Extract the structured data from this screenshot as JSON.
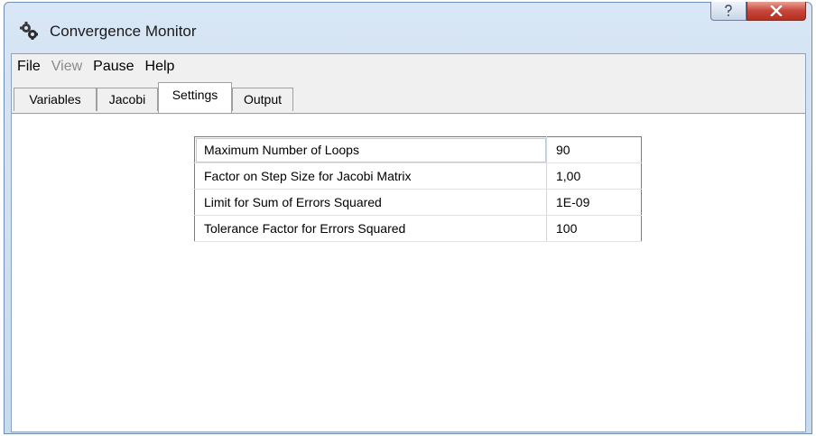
{
  "window": {
    "title": "Convergence Monitor",
    "icon": "gears-icon",
    "help_button": "?",
    "close_button": "X"
  },
  "menu": {
    "items": [
      {
        "label": "File",
        "enabled": true
      },
      {
        "label": "View",
        "enabled": false
      },
      {
        "label": "Pause",
        "enabled": true
      },
      {
        "label": "Help",
        "enabled": true
      }
    ]
  },
  "tabs": {
    "items": [
      {
        "label": "Variables"
      },
      {
        "label": "Jacobi"
      },
      {
        "label": "Settings"
      },
      {
        "label": "Output"
      }
    ],
    "active": "Settings"
  },
  "settings": {
    "rows": [
      {
        "name": "Maximum Number of Loops",
        "value": "90"
      },
      {
        "name": "Factor on Step Size for Jacobi Matrix",
        "value": "1,00"
      },
      {
        "name": "Limit for Sum of Errors Squared",
        "value": "1E-09"
      },
      {
        "name": "Tolerance Factor for Errors Squared",
        "value": "100"
      }
    ]
  },
  "colors": {
    "close_button": "#c7453a",
    "title_bar": "#d8e6f5",
    "disabled_text": "#8a8a8a"
  }
}
